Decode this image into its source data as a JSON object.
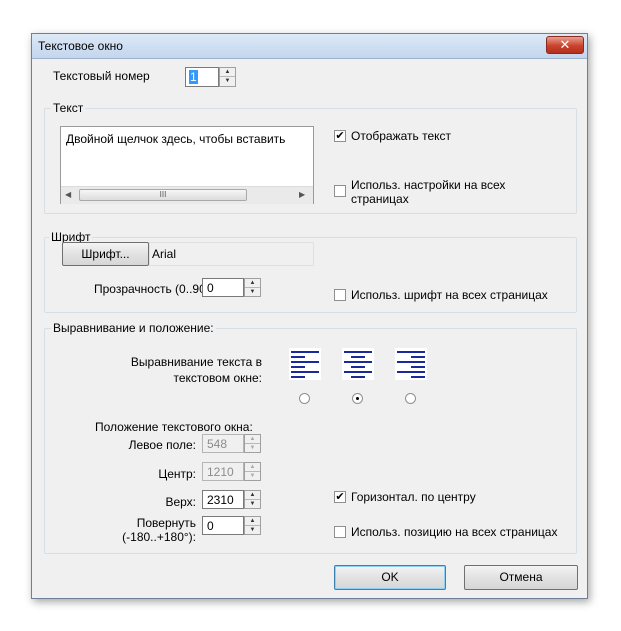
{
  "window": {
    "title": "Текстовое окно",
    "close_glyph": "✕"
  },
  "text_number": {
    "label": "Текстовый номер",
    "value": "1"
  },
  "text_group": {
    "title": "Текст",
    "textarea_value": "Двойной щелчок здесь, чтобы вставить",
    "scroll_thumb": "III",
    "show_text": {
      "label": "Отображать текст",
      "checked": true
    },
    "use_all_pages": {
      "label": "Использ. настройки на всех страницах",
      "checked": false
    }
  },
  "font_group": {
    "title": "Шрифт",
    "font_button": "Шрифт...",
    "font_name": "Arial",
    "transparency_label": "Прозрачность (0..90):",
    "transparency_value": "0",
    "use_font_all_pages": {
      "label": "Использ. шрифт  на всех страницах",
      "checked": false
    }
  },
  "align_group": {
    "title": "Выравнивание и положение:",
    "align_label_line1": "Выравнивание текста в",
    "align_label_line2": "текстовом окне:",
    "alignment_options": [
      "left",
      "center",
      "right"
    ],
    "selected_alignment": "center",
    "position_label": "Положение текстового окна:",
    "left_margin": {
      "label": "Левое поле:",
      "value": "548"
    },
    "center": {
      "label": "Центр:",
      "value": "1210"
    },
    "top": {
      "label": "Верх:",
      "value": "2310"
    },
    "rotate": {
      "label_line1": "Повернуть",
      "label_line2": "(-180..+180°):",
      "value": "0"
    },
    "horiz_center": {
      "label": "Горизонтал. по центру",
      "checked": true
    },
    "use_position_all_pages": {
      "label": "Использ. позицию  на всех страницах",
      "checked": false
    }
  },
  "buttons": {
    "ok": "OK",
    "cancel": "Отмена"
  },
  "icons": {
    "check": "✔",
    "up": "▲",
    "down": "▼",
    "left": "◀",
    "right": "▶"
  }
}
